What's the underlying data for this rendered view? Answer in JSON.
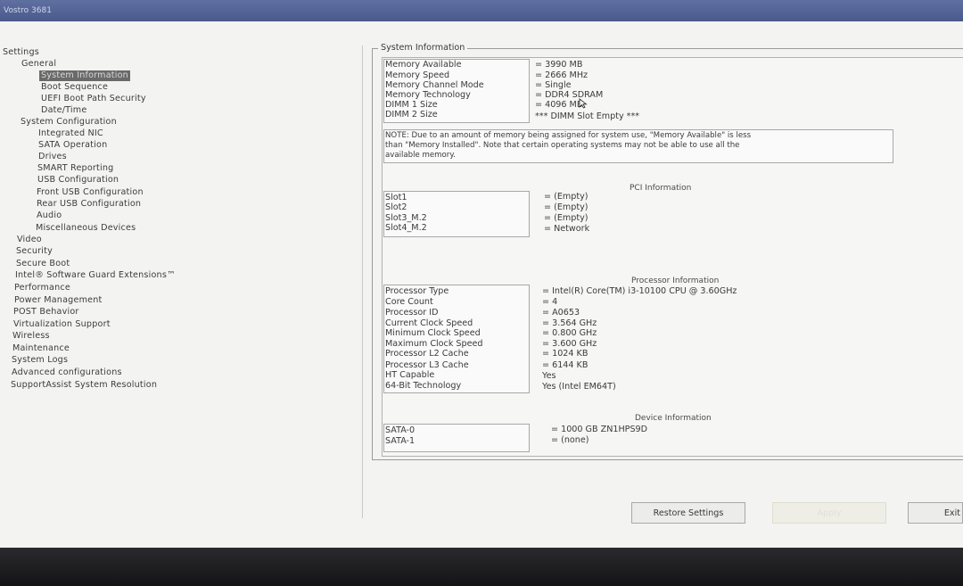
{
  "window": {
    "title": "Vostro 3681"
  },
  "sidebar": {
    "items": [
      {
        "label": "Settings",
        "level": 0
      },
      {
        "label": "General",
        "level": 1
      },
      {
        "label": "System Information",
        "level": 2,
        "selected": true
      },
      {
        "label": "Boot Sequence",
        "level": 2
      },
      {
        "label": "UEFI Boot Path Security",
        "level": 2
      },
      {
        "label": "Date/Time",
        "level": 2
      },
      {
        "label": "System Configuration",
        "level": 1
      },
      {
        "label": "Integrated NIC",
        "level": 2
      },
      {
        "label": "SATA Operation",
        "level": 2
      },
      {
        "label": "Drives",
        "level": 2
      },
      {
        "label": "SMART Reporting",
        "level": 2
      },
      {
        "label": "USB Configuration",
        "level": 2
      },
      {
        "label": "Front USB Configuration",
        "level": 2
      },
      {
        "label": "Rear USB Configuration",
        "level": 2
      },
      {
        "label": "Audio",
        "level": 2
      },
      {
        "label": "Miscellaneous Devices",
        "level": 2
      },
      {
        "label": "Video",
        "level": 1
      },
      {
        "label": "Security",
        "level": 1
      },
      {
        "label": "Secure Boot",
        "level": 1
      },
      {
        "label": "Intel® Software Guard Extensions™",
        "level": 1
      },
      {
        "label": "Performance",
        "level": 1
      },
      {
        "label": "Power Management",
        "level": 1
      },
      {
        "label": "POST Behavior",
        "level": 1
      },
      {
        "label": "Virtualization Support",
        "level": 1
      },
      {
        "label": "Wireless",
        "level": 1
      },
      {
        "label": "Maintenance",
        "level": 1
      },
      {
        "label": "System Logs",
        "level": 1
      },
      {
        "label": "Advanced configurations",
        "level": 1
      },
      {
        "label": "SupportAssist System Resolution",
        "level": 1
      }
    ]
  },
  "panel": {
    "title": "System Information",
    "memory": [
      {
        "label": "Memory Available",
        "value": "= 3990 MB"
      },
      {
        "label": "Memory Speed",
        "value": "= 2666 MHz"
      },
      {
        "label": "Memory Channel Mode",
        "value": "= Single"
      },
      {
        "label": "Memory Technology",
        "value": "= DDR4 SDRAM"
      },
      {
        "label": "DIMM 1 Size",
        "value": "= 4096 MB"
      },
      {
        "label": "DIMM 2 Size",
        "value": "*** DIMM Slot Empty ***"
      }
    ],
    "note_lines": [
      "NOTE: Due to an amount of memory being assigned for system use, \"Memory Available\" is less",
      "than \"Memory Installed\". Note that certain operating systems may not be able to use all the",
      "available memory."
    ],
    "pci": {
      "heading": "PCI Information",
      "rows": [
        {
          "label": "Slot1",
          "value": "= (Empty)"
        },
        {
          "label": "Slot2",
          "value": "= (Empty)"
        },
        {
          "label": "Slot3_M.2",
          "value": "= (Empty)"
        },
        {
          "label": "Slot4_M.2",
          "value": "= Network"
        }
      ]
    },
    "processor": {
      "heading": "Processor Information",
      "rows": [
        {
          "label": "Processor Type",
          "value": "= Intel(R) Core(TM) i3-10100 CPU @ 3.60GHz"
        },
        {
          "label": "Core Count",
          "value": "= 4"
        },
        {
          "label": "Processor ID",
          "value": "= A0653"
        },
        {
          "label": "Current Clock Speed",
          "value": "= 3.564 GHz"
        },
        {
          "label": "Minimum Clock Speed",
          "value": "= 0.800 GHz"
        },
        {
          "label": "Maximum Clock Speed",
          "value": "= 3.600 GHz"
        },
        {
          "label": "Processor L2 Cache",
          "value": "= 1024 KB"
        },
        {
          "label": "Processor L3 Cache",
          "value": "= 6144 KB"
        },
        {
          "label": "HT Capable",
          "value": "Yes"
        },
        {
          "label": "64-Bit Technology",
          "value": "Yes (Intel EM64T)"
        }
      ]
    },
    "device": {
      "heading": "Device Information",
      "rows": [
        {
          "label": "SATA-0",
          "value": "= 1000 GB ZN1HPS9D"
        },
        {
          "label": "SATA-1",
          "value": "= (none)"
        }
      ]
    }
  },
  "buttons": {
    "restore": "Restore Settings",
    "apply": "Apply",
    "exit": "Exit"
  }
}
